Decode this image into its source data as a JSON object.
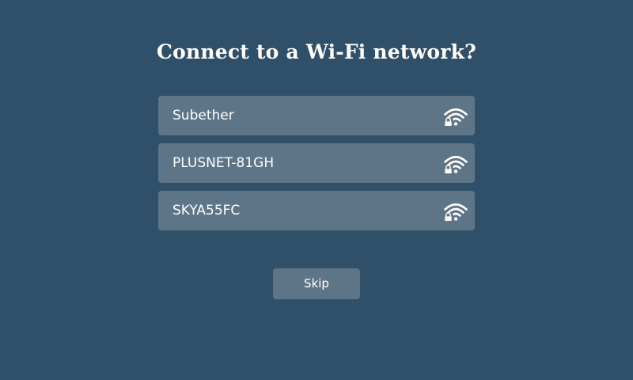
{
  "page": {
    "title": "Connect to a Wi-Fi network?"
  },
  "networks": [
    {
      "ssid": "Subether",
      "icon": "wifi-lock-icon",
      "secured": true
    },
    {
      "ssid": "PLUSNET-81GH",
      "icon": "wifi-lock-icon",
      "secured": true
    },
    {
      "ssid": "SKYA55FC",
      "icon": "wifi-lock-icon",
      "secured": true
    }
  ],
  "actions": {
    "skip_label": "Skip"
  },
  "colors": {
    "background": "#2f5068",
    "row": "#5e7588",
    "text": "#ffffff"
  }
}
